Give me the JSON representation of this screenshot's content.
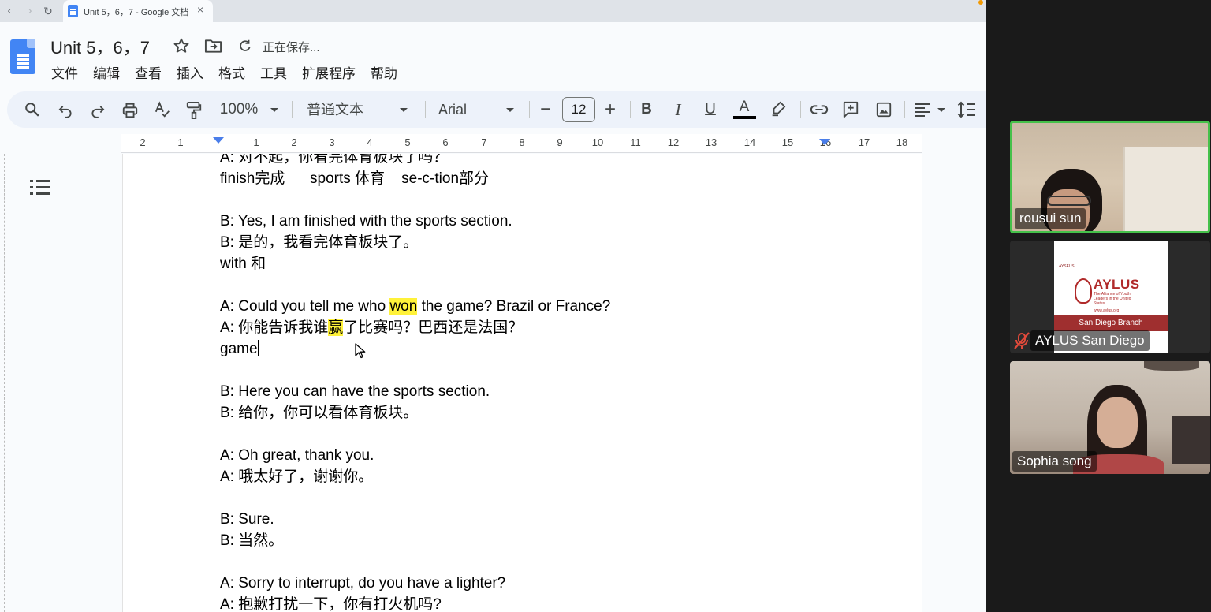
{
  "browser": {
    "tab_title": "Unit 5，6，7 - Google 文档",
    "back_icon": "‹",
    "forward_icon": "›",
    "reload_icon": "↻",
    "close_icon": "×"
  },
  "doc": {
    "title": "Unit 5，6，7",
    "saving_status": "正在保存...",
    "menu": [
      "文件",
      "编辑",
      "查看",
      "插入",
      "格式",
      "工具",
      "扩展程序",
      "帮助"
    ]
  },
  "toolbar": {
    "zoom": "100%",
    "style": "普通文本",
    "font": "Arial",
    "font_size": "12",
    "minus": "−",
    "plus": "+",
    "bold": "B",
    "italic": "I",
    "underline": "U",
    "text_color": "A"
  },
  "ruler": {
    "labels": [
      "2",
      "1",
      "1",
      "2",
      "3",
      "4",
      "5",
      "6",
      "7",
      "8",
      "9",
      "10",
      "11",
      "12",
      "13",
      "14",
      "15",
      "16",
      "17",
      "18"
    ]
  },
  "content": {
    "lines": [
      "A: 对不起，你看完体育板块了吗？",
      "finish完成      sports 体育    se-c-tion部分",
      "",
      "B: Yes, I am finished with the sports section.",
      "B: 是的，我看完体育板块了。",
      "with 和",
      "",
      "",
      "",
      "game",
      "",
      "B: Here you can have the sports section.",
      "B: 给你，你可以看体育板块。",
      "",
      "A: Oh great, thank you.",
      "A: 哦太好了，谢谢你。",
      "",
      "B: Sure.",
      "B: 当然。",
      "",
      "A: Sorry to interrupt, do you have a lighter?",
      "A: 抱歉打扰一下，你有打火机吗?"
    ],
    "line_7_before": "A: Could you tell me who ",
    "line_7_highlight": "won",
    "line_7_after": " the game? Brazil or France?",
    "line_8_before": "A: 你能告诉我谁",
    "line_8_highlight": "赢",
    "line_8_after": "了比赛吗？巴西还是法国？"
  },
  "participants": [
    {
      "name": "rousui sun",
      "active_speaker": true
    },
    {
      "name": "AYLUS San Diego",
      "muted": true
    },
    {
      "name": "Sophia song"
    }
  ],
  "aylus_card": {
    "small_logo": "AYSFUS",
    "name": "AYLUS",
    "subtitle": "The Alliance of Youth Leaders in the United States",
    "url": "www.aylus.org",
    "branch": "San Diego Branch"
  },
  "colors": {
    "highlight": "#fff23a",
    "active_speaker_border": "#45c14a",
    "docs_blue": "#4285f4",
    "aylus_red": "#9f2f2f"
  }
}
